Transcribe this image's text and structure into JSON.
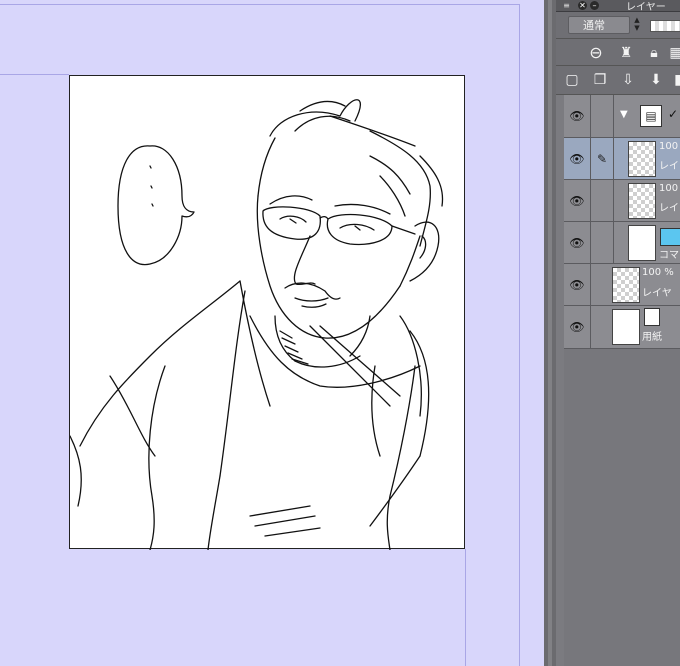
{
  "panel": {
    "title": "レイヤー",
    "blend_mode": "通常",
    "icons": {
      "close": "close-icon",
      "minimize": "minimize-icon",
      "menu": "panel-menu-icon"
    }
  },
  "layers": [
    {
      "name": "folder-layer",
      "line1": "",
      "line2": "",
      "kind": "folder"
    },
    {
      "name": "layer-1",
      "line1": "100",
      "line2": "レイ",
      "kind": "raster",
      "selected": true
    },
    {
      "name": "layer-2",
      "line1": "100",
      "line2": "レイ",
      "kind": "raster"
    },
    {
      "name": "frame-layer",
      "line1": "",
      "line2": "コマ",
      "kind": "frame"
    },
    {
      "name": "layer-3",
      "line1": "100 %",
      "line2": "レイヤ",
      "kind": "raster"
    },
    {
      "name": "paper-layer",
      "line1": "",
      "line2": "用紙",
      "kind": "paper"
    }
  ],
  "colors": {
    "canvas_bg": "#d8d6fb",
    "panel_bg": "#7b7b80",
    "selected_row": "#9aa8bf",
    "frame_color": "#5bc6f0"
  }
}
